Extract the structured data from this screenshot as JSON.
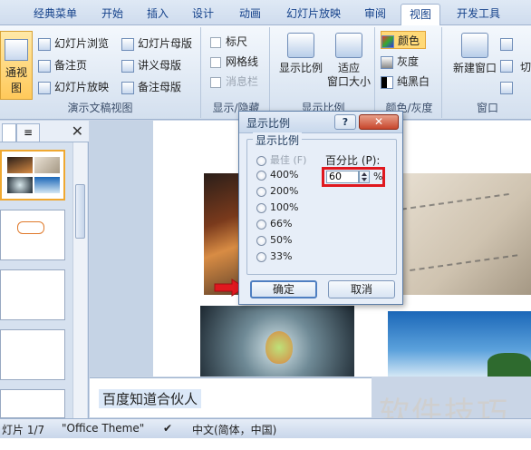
{
  "tabs": [
    {
      "label": "经典菜单",
      "active": false
    },
    {
      "label": "开始",
      "active": false
    },
    {
      "label": "插入",
      "active": false
    },
    {
      "label": "设计",
      "active": false
    },
    {
      "label": "动画",
      "active": false
    },
    {
      "label": "幻灯片放映",
      "active": false
    },
    {
      "label": "审阅",
      "active": false
    },
    {
      "label": "视图",
      "active": true
    },
    {
      "label": "开发工具",
      "active": false
    }
  ],
  "ribbon": {
    "views_group": {
      "label": "演示文稿视图",
      "normal": "通视图",
      "items": [
        "幻灯片浏览",
        "备注页",
        "幻灯片放映",
        "幻灯片母版",
        "讲义母版",
        "备注母版"
      ]
    },
    "show_group": {
      "label": "显示/隐藏",
      "items": [
        "标尺",
        "网格线",
        "消息栏"
      ]
    },
    "zoom_group": {
      "label": "显示比例",
      "zoom": "显示比例",
      "fit_line1": "适应",
      "fit_line2": "窗口大小"
    },
    "color_group": {
      "label": "颜色/灰度",
      "items": [
        "颜色",
        "灰度",
        "纯黑白"
      ]
    },
    "window_group": {
      "label": "窗口",
      "new_window": "新建窗口",
      "partial": "切"
    }
  },
  "left_panel": {
    "tab_outline": "≡",
    "close": "✕"
  },
  "notes": {
    "text": "百度知道合伙人"
  },
  "status": {
    "slide": "灯片 1/7",
    "theme": "\"Office Theme\"",
    "language": "中文(简体，中国)"
  },
  "watermark": "软件技巧",
  "dialog": {
    "title": "显示比例",
    "help": "?",
    "close": "✕",
    "group_label": "显示比例",
    "options": [
      {
        "label": "最佳 (F)",
        "enabled": false
      },
      {
        "label": "400%",
        "enabled": true
      },
      {
        "label": "200%",
        "enabled": true
      },
      {
        "label": "100%",
        "enabled": true
      },
      {
        "label": "66%",
        "enabled": true
      },
      {
        "label": "50%",
        "enabled": true
      },
      {
        "label": "33%",
        "enabled": true
      }
    ],
    "percent_label": "百分比 (P):",
    "percent_value": "60",
    "percent_unit": "%",
    "ok": "确定",
    "cancel": "取消"
  },
  "colors": {
    "highlight": "#e0181f",
    "accent": "#15428b"
  }
}
